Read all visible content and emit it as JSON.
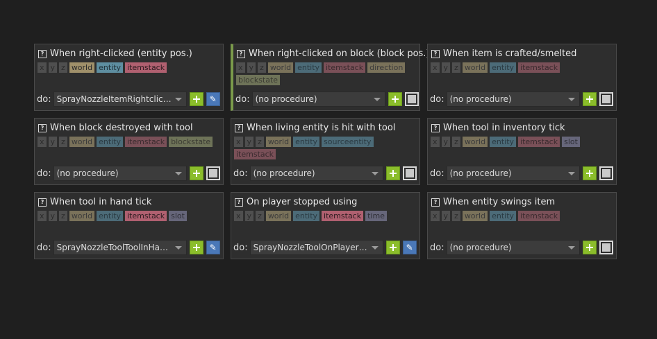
{
  "procedures": [
    {
      "title": "When right-clicked (entity pos.)",
      "deps": [
        {
          "label": "x",
          "kind": "coord",
          "dim": true
        },
        {
          "label": "y",
          "kind": "coord",
          "dim": true
        },
        {
          "label": "z",
          "kind": "coord",
          "dim": true
        },
        {
          "label": "world",
          "kind": "world",
          "dim": false
        },
        {
          "label": "entity",
          "kind": "entity",
          "dim": false
        },
        {
          "label": "itemstack",
          "kind": "itemstack",
          "dim": false
        }
      ],
      "do_label": "do:",
      "procedure": "SprayNozzleItemRightclicked",
      "has_procedure": true,
      "active": false
    },
    {
      "title": "When right-clicked on block (block pos.)",
      "deps": [
        {
          "label": "x",
          "kind": "coord",
          "dim": true
        },
        {
          "label": "y",
          "kind": "coord",
          "dim": true
        },
        {
          "label": "z",
          "kind": "coord",
          "dim": true
        },
        {
          "label": "world",
          "kind": "world",
          "dim": true
        },
        {
          "label": "entity",
          "kind": "entity",
          "dim": true
        },
        {
          "label": "itemstack",
          "kind": "itemstack",
          "dim": true
        },
        {
          "label": "direction",
          "kind": "direction",
          "dim": true
        },
        {
          "label": "blockstate",
          "kind": "blockstate",
          "dim": true
        }
      ],
      "do_label": "do:",
      "procedure": "(no procedure)",
      "has_procedure": false,
      "active": true
    },
    {
      "title": "When item is crafted/smelted",
      "deps": [
        {
          "label": "x",
          "kind": "coord",
          "dim": true
        },
        {
          "label": "y",
          "kind": "coord",
          "dim": true
        },
        {
          "label": "z",
          "kind": "coord",
          "dim": true
        },
        {
          "label": "world",
          "kind": "world",
          "dim": true
        },
        {
          "label": "entity",
          "kind": "entity",
          "dim": true
        },
        {
          "label": "itemstack",
          "kind": "itemstack",
          "dim": true
        }
      ],
      "do_label": "do:",
      "procedure": "(no procedure)",
      "has_procedure": false,
      "active": false
    },
    {
      "title": "When block destroyed with tool",
      "deps": [
        {
          "label": "x",
          "kind": "coord",
          "dim": true
        },
        {
          "label": "y",
          "kind": "coord",
          "dim": true
        },
        {
          "label": "z",
          "kind": "coord",
          "dim": true
        },
        {
          "label": "world",
          "kind": "world",
          "dim": true
        },
        {
          "label": "entity",
          "kind": "entity",
          "dim": true
        },
        {
          "label": "itemstack",
          "kind": "itemstack",
          "dim": true
        },
        {
          "label": "blockstate",
          "kind": "blockstate",
          "dim": true
        }
      ],
      "do_label": "do:",
      "procedure": "(no procedure)",
      "has_procedure": false,
      "active": false
    },
    {
      "title": "When living entity is hit with tool",
      "deps": [
        {
          "label": "x",
          "kind": "coord",
          "dim": true
        },
        {
          "label": "y",
          "kind": "coord",
          "dim": true
        },
        {
          "label": "z",
          "kind": "coord",
          "dim": true
        },
        {
          "label": "world",
          "kind": "world",
          "dim": true
        },
        {
          "label": "entity",
          "kind": "entity",
          "dim": true
        },
        {
          "label": "sourceentity",
          "kind": "sourceentity",
          "dim": true
        },
        {
          "label": "itemstack",
          "kind": "itemstack",
          "dim": true
        }
      ],
      "do_label": "do:",
      "procedure": "(no procedure)",
      "has_procedure": false,
      "active": false
    },
    {
      "title": "When tool in inventory tick",
      "deps": [
        {
          "label": "x",
          "kind": "coord",
          "dim": true
        },
        {
          "label": "y",
          "kind": "coord",
          "dim": true
        },
        {
          "label": "z",
          "kind": "coord",
          "dim": true
        },
        {
          "label": "world",
          "kind": "world",
          "dim": true
        },
        {
          "label": "entity",
          "kind": "entity",
          "dim": true
        },
        {
          "label": "itemstack",
          "kind": "itemstack",
          "dim": true
        },
        {
          "label": "slot",
          "kind": "slot",
          "dim": true
        }
      ],
      "do_label": "do:",
      "procedure": "(no procedure)",
      "has_procedure": false,
      "active": false
    },
    {
      "title": "When tool in hand tick",
      "deps": [
        {
          "label": "x",
          "kind": "coord",
          "dim": true
        },
        {
          "label": "y",
          "kind": "coord",
          "dim": true
        },
        {
          "label": "z",
          "kind": "coord",
          "dim": true
        },
        {
          "label": "world",
          "kind": "world",
          "dim": true
        },
        {
          "label": "entity",
          "kind": "entity",
          "dim": true
        },
        {
          "label": "itemstack",
          "kind": "itemstack",
          "dim": false
        },
        {
          "label": "slot",
          "kind": "slot",
          "dim": true
        }
      ],
      "do_label": "do:",
      "procedure": "SprayNozzleToolToolInHandT...",
      "has_procedure": true,
      "active": false
    },
    {
      "title": "On player stopped using",
      "deps": [
        {
          "label": "x",
          "kind": "coord",
          "dim": true
        },
        {
          "label": "y",
          "kind": "coord",
          "dim": true
        },
        {
          "label": "z",
          "kind": "coord",
          "dim": true
        },
        {
          "label": "world",
          "kind": "world",
          "dim": true
        },
        {
          "label": "entity",
          "kind": "entity",
          "dim": true
        },
        {
          "label": "itemstack",
          "kind": "itemstack",
          "dim": false
        },
        {
          "label": "time",
          "kind": "time",
          "dim": true
        }
      ],
      "do_label": "do:",
      "procedure": "SprayNozzleToolOnPlayerSto...",
      "has_procedure": true,
      "active": false
    },
    {
      "title": "When entity swings item",
      "deps": [
        {
          "label": "x",
          "kind": "coord",
          "dim": true
        },
        {
          "label": "y",
          "kind": "coord",
          "dim": true
        },
        {
          "label": "z",
          "kind": "coord",
          "dim": true
        },
        {
          "label": "world",
          "kind": "world",
          "dim": true
        },
        {
          "label": "entity",
          "kind": "entity",
          "dim": true
        },
        {
          "label": "itemstack",
          "kind": "itemstack",
          "dim": true
        }
      ],
      "do_label": "do:",
      "procedure": "(no procedure)",
      "has_procedure": false,
      "active": false
    }
  ],
  "icons": {
    "help": "help-icon",
    "add": "plus-icon",
    "edit": "pencil-icon",
    "empty": "empty-box-icon"
  },
  "colors": {
    "background": "#1f1f1f",
    "card": "#2e2e2e",
    "active_bar": "#7a9a4a",
    "add_button": "#8bbd2b",
    "edit_button": "#4a78b8"
  }
}
